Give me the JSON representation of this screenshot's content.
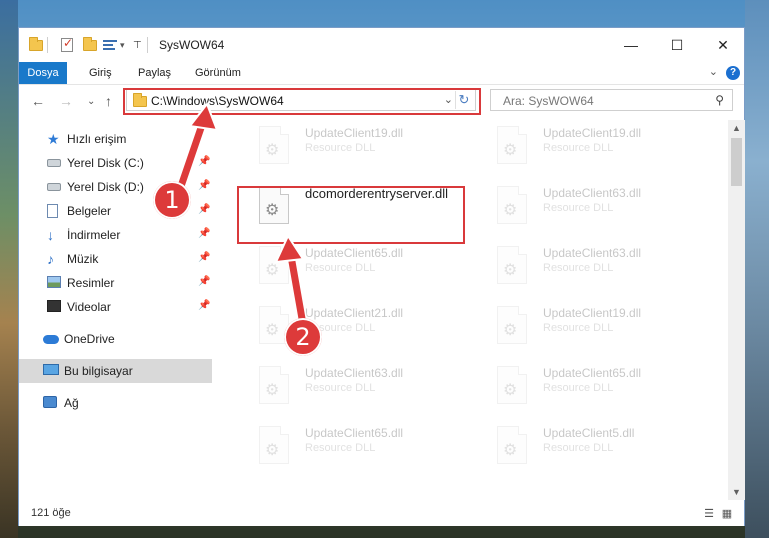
{
  "window": {
    "title": "SysWOW64",
    "controls": {
      "minimize": "—",
      "maximize": "☐",
      "close": "✕"
    }
  },
  "ribbon": {
    "tabs": [
      "Dosya",
      "Giriş",
      "Paylaş",
      "Görünüm"
    ],
    "collapse": "⌄",
    "help": "?"
  },
  "nav": {
    "back": "←",
    "forward": "→",
    "recent": "⌄",
    "up": "↑",
    "address": "C:\\Windows\\SysWOW64",
    "address_dropdown": "⌄",
    "refresh": "↻",
    "search_placeholder": "Ara: SysWOW64",
    "search_icon": "⚲"
  },
  "sidebar": {
    "items": [
      {
        "label": "Hızlı erişim",
        "icon": "star-icon",
        "pinned": false
      },
      {
        "label": "Yerel Disk (C:)",
        "icon": "disk-icon",
        "pinned": true
      },
      {
        "label": "Yerel Disk (D:)",
        "icon": "disk-icon",
        "pinned": true
      },
      {
        "label": "Belgeler",
        "icon": "document-icon",
        "pinned": true
      },
      {
        "label": "İndirmeler",
        "icon": "download-icon",
        "pinned": true
      },
      {
        "label": "Müzik",
        "icon": "music-icon",
        "pinned": true
      },
      {
        "label": "Resimler",
        "icon": "pictures-icon",
        "pinned": true
      },
      {
        "label": "Videolar",
        "icon": "video-icon",
        "pinned": true
      },
      {
        "label": "OneDrive",
        "icon": "cloud-icon",
        "pinned": false
      },
      {
        "label": "Bu bilgisayar",
        "icon": "computer-icon",
        "pinned": false,
        "selected": true
      },
      {
        "label": "Ağ",
        "icon": "network-icon",
        "pinned": false
      }
    ],
    "pin_glyph": "📌"
  },
  "files": {
    "type_label": "Resource DLL",
    "highlighted": {
      "name": "dcomorderentryserver.dll"
    },
    "left_column": [
      "UpdateClient19.dll",
      "dcomorderentryserver.dll",
      "UpdateClient65.dll",
      "UpdateClient21.dll",
      "UpdateClient63.dll",
      "UpdateClient65.dll"
    ],
    "right_column": [
      "UpdateClient19.dll",
      "UpdateClient63.dll",
      "UpdateClient63.dll",
      "UpdateClient19.dll",
      "UpdateClient65.dll",
      "UpdateClient5.dll"
    ],
    "gear_glyph": "⚙"
  },
  "status": {
    "count": "121 öğe",
    "view_details": "☰",
    "view_tiles": "▦"
  },
  "annotations": {
    "step1": "1",
    "step2": "2",
    "color": "#d9393b"
  }
}
